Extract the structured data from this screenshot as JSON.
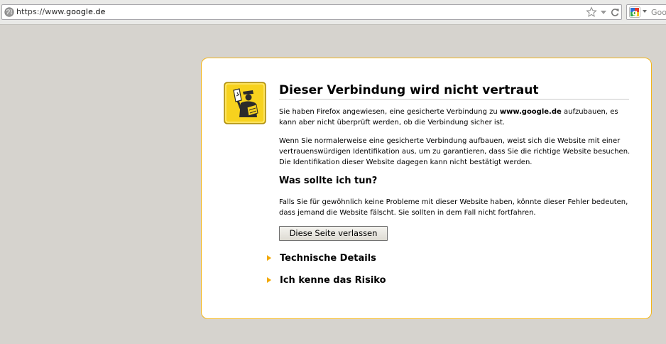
{
  "browser": {
    "url_prefix": "https://www.",
    "url_domain": "google.de",
    "search_placeholder": "Goo"
  },
  "error": {
    "title": "Dieser Verbindung wird nicht vertraut",
    "intro_before": "Sie haben Firefox angewiesen, eine gesicherte Verbindung zu ",
    "intro_domain": "www.google.de",
    "intro_after": " aufzubauen, es kann aber nicht überprüft werden, ob die Verbindung sicher ist.",
    "explanation": "Wenn Sie normalerweise eine gesicherte Verbindung aufbauen, weist sich die Website mit einer vertrauenswürdigen Identifikation aus, um zu garantieren, dass Sie die richtige Website besuchen. Die Identifikation dieser Website dagegen kann nicht bestätigt werden.",
    "what_heading": "Was sollte ich tun?",
    "what_text": "Falls Sie für gewöhnlich keine Probleme mit dieser Website haben, könnte dieser Fehler bedeuten, dass jemand die Website fälscht. Sie sollten in dem Fall nicht fortfahren.",
    "leave_button": "Diese Seite verlassen",
    "technical_details": "Technische Details",
    "understand_risks": "Ich kenne das Risiko"
  },
  "colors": {
    "accent": "#f2b51a",
    "page_background": "#d6d3ce"
  }
}
